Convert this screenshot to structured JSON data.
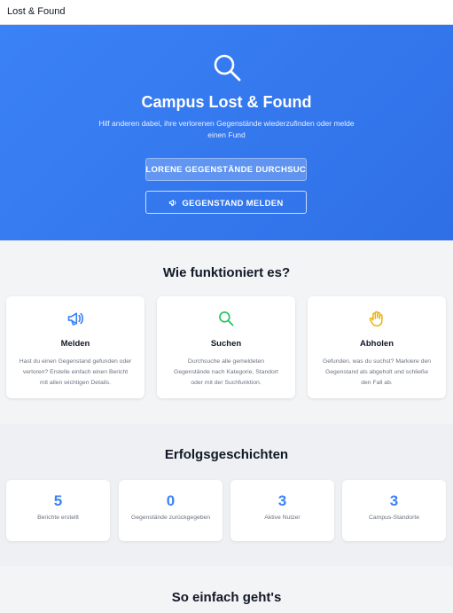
{
  "topbar": {
    "brand": "Lost & Found"
  },
  "hero": {
    "icon": "search-icon",
    "title": "Campus Lost & Found",
    "subtitle": "Hilf anderen dabei, ihre verlorenen Gegenstände wiederzufinden oder melde einen Fund",
    "primary_button": "VERLORENE GEGENSTÄNDE DURCHSUCHEN",
    "secondary_button": "GEGENSTAND MELDEN",
    "secondary_button_icon": "megaphone-icon"
  },
  "how_it_works": {
    "title": "Wie funktioniert es?",
    "steps": [
      {
        "icon": "megaphone-icon",
        "color": "#3b82f6",
        "title": "Melden",
        "text": "Hast du einen Gegenstand gefunden oder verloren? Erstelle einfach einen Bericht mit allen wichtigen Details."
      },
      {
        "icon": "search-icon",
        "color": "#22c55e",
        "title": "Suchen",
        "text": "Durchsuche alle gemeldeten Gegenstände nach Kategorie, Standort oder mit der Suchfunktion."
      },
      {
        "icon": "hand-icon",
        "color": "#eab308",
        "title": "Abholen",
        "text": "Gefunden, was du suchst? Markiere den Gegenstand als abgeholt und schließe den Fall ab."
      }
    ]
  },
  "success": {
    "title": "Erfolgsgeschichten",
    "stats": [
      {
        "value": "5",
        "label": "Berichte erstellt"
      },
      {
        "value": "0",
        "label": "Gegenstände zurückgegeben"
      },
      {
        "value": "3",
        "label": "Aktive Nutzer"
      },
      {
        "value": "3",
        "label": "Campus-Standorte"
      }
    ]
  },
  "easy": {
    "title": "So einfach geht's"
  },
  "colors": {
    "accent": "#3b82f6",
    "hero": "#3b82f6"
  }
}
